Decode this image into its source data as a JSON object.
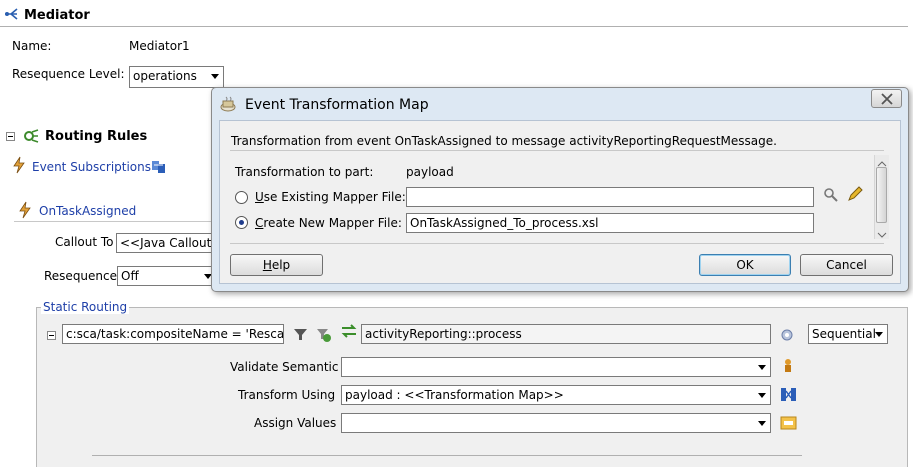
{
  "mediator": {
    "title": "Mediator",
    "name_label": "Name:",
    "name_value": "Mediator1",
    "resequence_label": "Resequence Level:",
    "resequence_value": "operations"
  },
  "routing": {
    "title": "Routing Rules",
    "event_subscriptions": "Event Subscriptions",
    "event_name": "OnTaskAssigned",
    "callout_label": "Callout To",
    "callout_value": "<<Java Callout",
    "resequence_label": "Resequence",
    "resequence_value": "Off",
    "static_routing_label": "Static Routing",
    "filter_expression": "c:sca/task:compositeName = 'Rescan'",
    "target": "activityReporting::process",
    "mode": "Sequential",
    "validate_label": "Validate Semantic",
    "validate_value": "",
    "transform_label": "Transform Using",
    "transform_value": "payload : <<Transformation Map>>",
    "assign_label": "Assign Values",
    "assign_value": ""
  },
  "dialog": {
    "title": "Event Transformation Map",
    "description": "Transformation from event OnTaskAssigned to message activityReportingRequestMessage.",
    "part_label": "Transformation to part:",
    "part_value": "payload",
    "use_existing_prefix": "U",
    "use_existing_rest": "se Existing Mapper File:",
    "use_existing_value": "",
    "create_new_prefix": "C",
    "create_new_rest": "reate New Mapper File:",
    "create_new_value": "OnTaskAssigned_To_process.xsl",
    "help_prefix": "H",
    "help_rest": "elp",
    "ok_label": "OK",
    "cancel_label": "Cancel",
    "selected_option": "create_new"
  },
  "colors": {
    "link_blue": "#1e3fa8",
    "dialog_border": "#8a8a8a",
    "panel_bg": "#f0f0f0"
  }
}
